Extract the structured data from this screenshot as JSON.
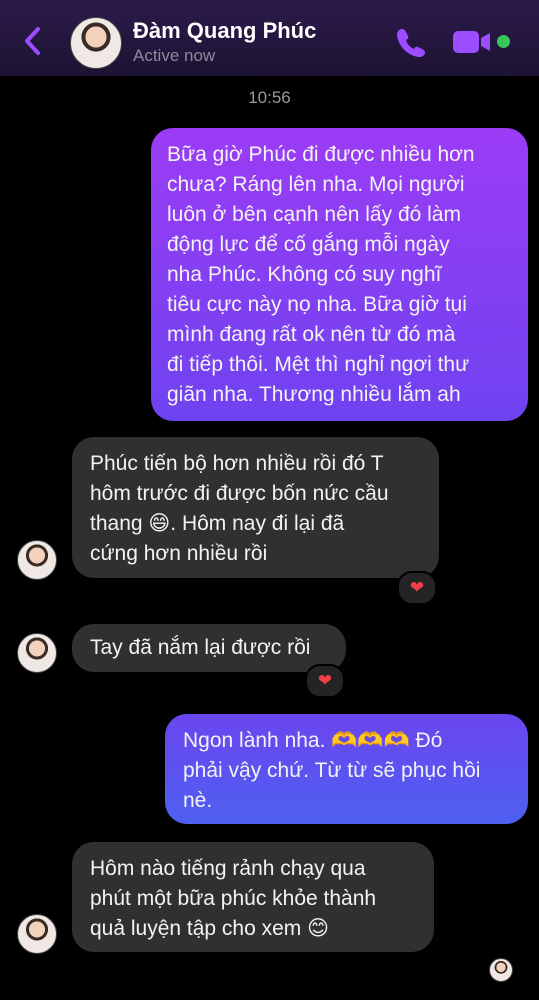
{
  "header": {
    "name": "Đàm Quang Phúc",
    "status": "Active now"
  },
  "conversation": {
    "timestamp": "10:56",
    "messages": [
      {
        "direction": "outgoing",
        "text": "Bữa giờ Phúc đi được nhiều hơn\nchưa? Ráng lên nha. Mọi người\nluôn ở bên cạnh nên lấy đó làm\nđộng lực để cố gắng mỗi ngày\nnha Phúc. Không có suy nghĩ\ntiêu cực này nọ nha. Bữa giờ tụi\nmình đang rất ok nên từ đó mà\nđi tiếp thôi. Mệt thì nghỉ ngơi thư\ngiãn nha. Thương nhiều lắm ah"
      },
      {
        "direction": "incoming",
        "text": "Phúc tiến bộ hơn nhiều rồi đó T\nhôm trước đi được bốn nức cầu\nthang 😄. Hôm nay đi lại đã\ncứng hơn nhiều rồi",
        "reaction": "❤"
      },
      {
        "direction": "incoming",
        "text": "Tay đã nắm lại được rồi",
        "reaction": "❤"
      },
      {
        "direction": "outgoing",
        "text": "Ngon lành nha. 🫶🫶🫶 Đó\nphải vậy chứ. Từ từ sẽ phục hồi\nnè."
      },
      {
        "direction": "incoming",
        "text": "Hôm nào tiếng rảnh chạy qua\nphút một bữa phúc khỏe thành\nquả luyện tập cho xem 😊"
      }
    ]
  },
  "colors": {
    "accent": "#9b4dff",
    "outgoing_bubble_top": "#9b3cf5",
    "outgoing_bubble_bottom": "#4d60f0",
    "incoming_bubble": "#303030",
    "online": "#35c759"
  }
}
